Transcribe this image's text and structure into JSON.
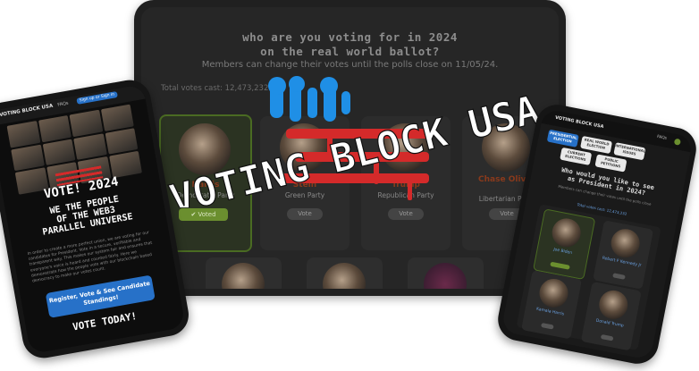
{
  "tablet": {
    "title_line1": "Who are you voting for in 2024",
    "title_line2": "on the real world ballot?",
    "subtitle": "Members can change their votes until the polls close on 11/05/24.",
    "total_votes": "Total votes cast: 12,473,232",
    "candidates": [
      {
        "name": "Harris",
        "party": "Democratic Party",
        "button": "Voted",
        "voted": true
      },
      {
        "name": "Stein",
        "party": "Green Party",
        "button": "Vote",
        "voted": false
      },
      {
        "name": "Trump",
        "party": "Republican Party",
        "button": "Vote",
        "voted": false
      },
      {
        "name": "Chase Oliver",
        "party": "Libertarian Party",
        "button": "Vote",
        "voted": false
      }
    ]
  },
  "logo": {
    "text": "VOTING BLOCK USA"
  },
  "phone_left": {
    "brand": "VOTING BLOCK USA",
    "nav_faqs": "FAQs",
    "nav_signup": "Sign up or Sign in",
    "headline": "VOTE! 2024",
    "people_line1": "WE THE PEOPLE",
    "people_line2": "OF THE WEB3",
    "people_line3": "PARALLEL UNIVERSE",
    "body": "In order to create a more perfect union, we are voting for our candidates for President. Vote in a secure, verifiable and transparent way. This makes our system fair and ensures that everyone's voice is heard and counted fairly. Here we demonstrate how the people vote with our blockchain based democracy to make our votes count.",
    "cta": "Register, Vote & See Candidate Standings!",
    "footer": "VOTE TODAY!"
  },
  "phone_right": {
    "brand": "VOTING BLOCK USA",
    "nav_faqs": "FAQs",
    "tabs": [
      "PRESIDENTIAL ELECTION",
      "REAL WORLD ELECTION",
      "INTERNATIONAL ISSUES",
      "CURRENT ELECTIONS",
      "PUBLIC PETITIONS"
    ],
    "question_line1": "Who would you like to see",
    "question_line2": "as President in 2024?",
    "subtitle": "Members can change their votes until the polls close",
    "total_votes": "Total votes cast: 12,473,232",
    "cards": [
      {
        "name": "Joe Biden",
        "button": "Voted",
        "voted": true
      },
      {
        "name": "Robert F Kennedy Jr",
        "button": "Vote",
        "voted": false
      },
      {
        "name": "Kamala Harris",
        "button": "Vote",
        "voted": false
      },
      {
        "name": "Donald Trump",
        "button": "Vote",
        "voted": false
      }
    ]
  },
  "colors": {
    "accent_red": "#d42a2a",
    "accent_blue": "#2771c8",
    "voted_green": "#6b8f2f",
    "screen_bg": "#262626"
  }
}
